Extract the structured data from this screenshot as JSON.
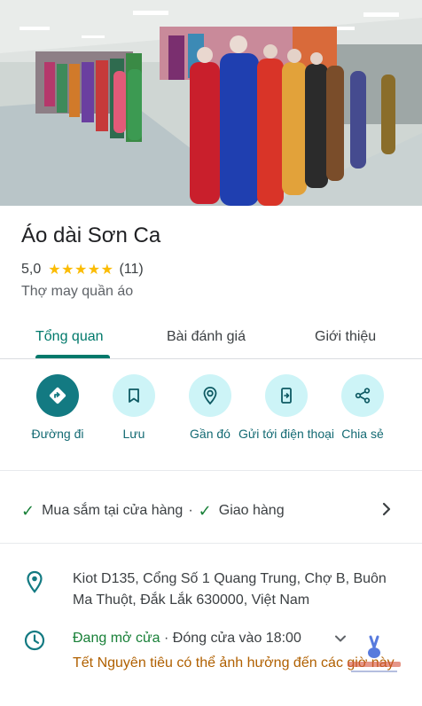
{
  "place": {
    "name": "Áo dài Sơn Ca",
    "rating": "5,0",
    "stars": "★★★★★",
    "review_count": "(11)",
    "category": "Thợ may quần áo"
  },
  "tabs": [
    {
      "label": "Tổng quan",
      "active": true
    },
    {
      "label": "Bài đánh giá",
      "active": false
    },
    {
      "label": "Giới thiệu",
      "active": false
    }
  ],
  "actions": [
    {
      "label": "Đường đi",
      "icon": "directions-icon"
    },
    {
      "label": "Lưu",
      "icon": "bookmark-icon"
    },
    {
      "label": "Gần đó",
      "icon": "nearby-icon"
    },
    {
      "label": "Gửi tới điện thoại",
      "icon": "send-to-phone-icon"
    },
    {
      "label": "Chia sẻ",
      "icon": "share-icon"
    }
  ],
  "services": {
    "item1": "Mua sắm tại cửa hàng",
    "separator": "·",
    "item2": "Giao hàng"
  },
  "address": "Kiot D135, Cổng Số 1 Quang Trung, Chợ B, Buôn Ma Thuột, Đắk Lắk 630000, Việt Nam",
  "hours": {
    "status": "Đang mở cửa",
    "closing": "· Đóng cửa vào 18:00",
    "holiday_note": "Tết Nguyên tiêu có thể ảnh hưởng đến các giờ này"
  },
  "colors": {
    "accent": "#00796b",
    "action_primary": "#137a82",
    "action_bg": "#cdf4f7",
    "open_green": "#188038",
    "holiday_orange": "#b06000",
    "star": "#fbbc04"
  }
}
